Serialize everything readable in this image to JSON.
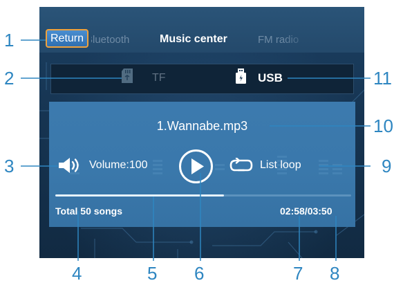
{
  "top_bar": {
    "return_label": "Return",
    "tabs": [
      {
        "label": "Bluetooth",
        "state": "inactive"
      },
      {
        "label": "Music center",
        "state": "active"
      },
      {
        "label": "FM radio",
        "state": "inactive"
      }
    ]
  },
  "source": {
    "tf_label": "TF",
    "tf_icon": "sd-card-icon",
    "usb_label": "USB",
    "usb_icon": "usb-drive-icon",
    "selected": "USB"
  },
  "player": {
    "song_title": "1.Wannabe.mp3",
    "volume_label": "Volume:100",
    "volume_icon": "speaker-icon",
    "play_icon": "play-icon",
    "loop_label": "List loop",
    "loop_icon": "loop-icon",
    "progress_fraction": 0.57,
    "total_songs": "Total 50 songs",
    "time": "02:58/03:50"
  },
  "callouts": {
    "n1": "1",
    "n2": "2",
    "n3": "3",
    "n4": "4",
    "n5": "5",
    "n6": "6",
    "n7": "7",
    "n8": "8",
    "n9": "9",
    "n10": "10",
    "n11": "11"
  },
  "colors": {
    "callout_blue": "#2e86c1",
    "return_border": "#f0a23c",
    "panel_blue": "#3a78ab",
    "screen_dark": "#163451"
  }
}
